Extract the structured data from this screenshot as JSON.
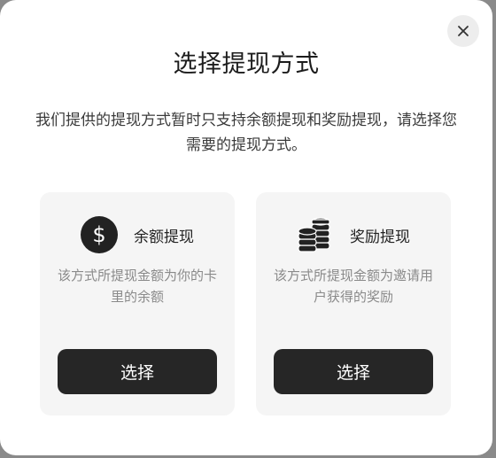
{
  "dialog": {
    "title": "选择提现方式",
    "description": "我们提供的提现方式暂时只支持余额提现和奖励提现，请选择您需要的提现方式。",
    "close_icon": "close-icon"
  },
  "options": [
    {
      "icon": "dollar-coin-icon",
      "title": "余额提现",
      "description": "该方式所提现金额为你的卡里的余额",
      "button_label": "选择"
    },
    {
      "icon": "coin-stack-icon",
      "title": "奖励提现",
      "description": "该方式所提现金额为邀请用户获得的奖励",
      "button_label": "选择"
    }
  ],
  "colors": {
    "button_bg": "#262626",
    "card_bg": "#f5f5f5",
    "muted_text": "#8a8a8a"
  }
}
